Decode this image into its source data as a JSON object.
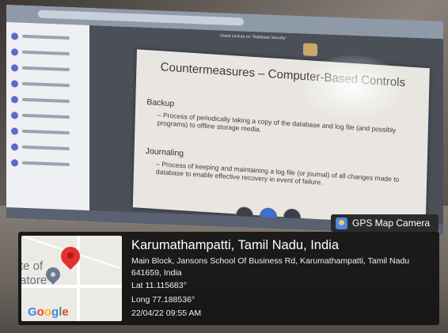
{
  "slide": {
    "title": "Countermeasures – Computer-Based Controls",
    "bullets": [
      {
        "label": "Backup",
        "text": "– Process of periodically taking a copy of the database and log file (and possibly programs) to offline storage media."
      },
      {
        "label": "Journaling",
        "text": "– Process of keeping and maintaining a log file (or journal) of all changes made to database to enable effective recovery in event of failure."
      }
    ]
  },
  "meeting": {
    "title": "Guest Lecture on \"Database Security\""
  },
  "gps_badge": {
    "label": "GPS Map Camera",
    "icon": "gps-map-camera-icon"
  },
  "map": {
    "text_line1": "te of",
    "text_line2": "atore",
    "logo": "Google",
    "pin_color": "#e2312f"
  },
  "location": {
    "title": "Karumathampatti, Tamil Nadu, India",
    "address": "Main Block, Jansons School Of Business Rd, Karumathampatti, Tamil Nadu 641659, India",
    "lat": "Lat 11.115683°",
    "long": "Long 77.188536°",
    "datetime": "22/04/22 09:55 AM"
  }
}
